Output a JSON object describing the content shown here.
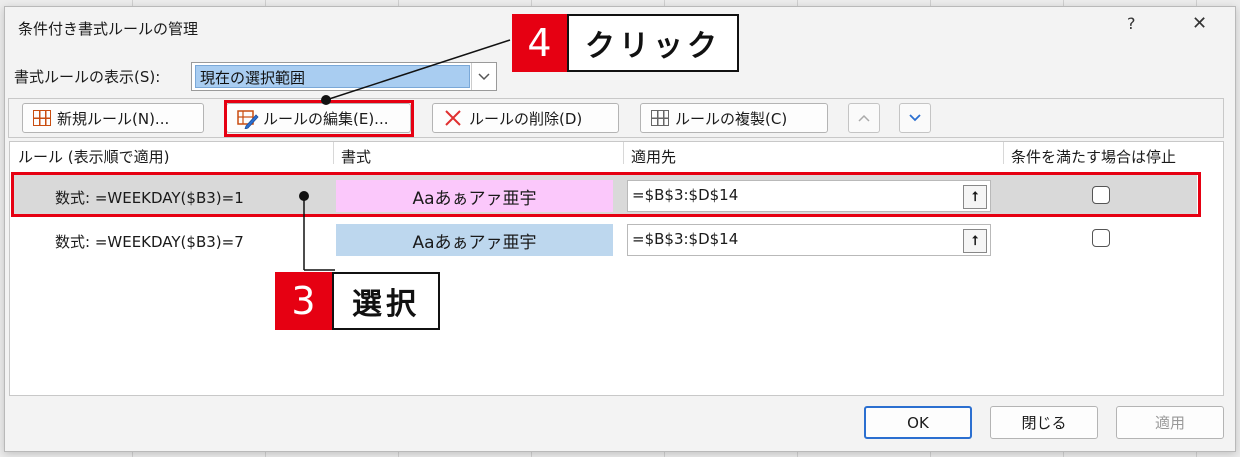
{
  "dialog": {
    "title": "条件付き書式ルールの管理",
    "help_label": "?",
    "close_label": "✕"
  },
  "show_rules": {
    "label": "書式ルールの表示(S):",
    "value": "現在の選択範囲"
  },
  "toolbar": {
    "new_rule": "新規ルール(N)...",
    "edit_rule": "ルールの編集(E)...",
    "delete_rule": "ルールの削除(D)",
    "duplicate_rule": "ルールの複製(C)",
    "move_up": "^",
    "move_down": "v"
  },
  "table": {
    "headers": [
      "ルール (表示順で適用)",
      "書式",
      "適用先",
      "条件を満たす場合は停止"
    ],
    "rows": [
      {
        "rule": "数式: =WEEKDAY($B3)=1",
        "format_preview": "Aaあぁアァ亜宇",
        "format_color": "#fbc8fb",
        "applies_to": "=$B$3:$D$14",
        "stop_if_true": false,
        "selected": true
      },
      {
        "rule": "数式: =WEEKDAY($B3)=7",
        "format_preview": "Aaあぁアァ亜宇",
        "format_color": "#bdd7ee",
        "applies_to": "=$B$3:$D$14",
        "stop_if_true": false,
        "selected": false
      }
    ]
  },
  "footer": {
    "ok": "OK",
    "close": "閉じる",
    "apply": "適用"
  },
  "annotations": {
    "step4_num": "4",
    "step4_text": "クリック",
    "step3_num": "3",
    "step3_text": "選択",
    "accent": "#e60012"
  }
}
